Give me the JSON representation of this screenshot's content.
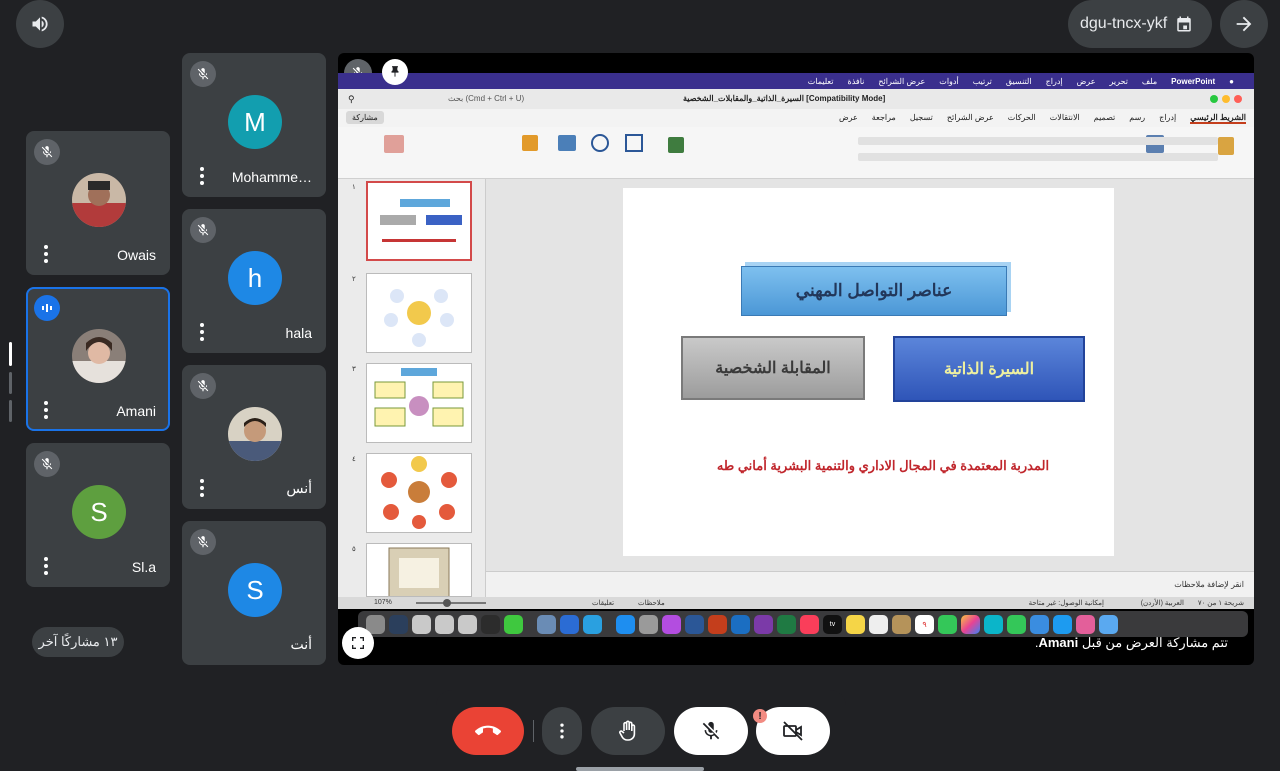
{
  "meeting": {
    "code": "dgu-tncx-ykf",
    "others_label": "١٣ مشاركًا آخر",
    "share_caption_prefix": "تتم مشاركة العرض من قبل",
    "share_caption_name": "Amani",
    "share_caption_suffix": "."
  },
  "participants": [
    {
      "name": "Owais",
      "muted": true
    },
    {
      "name": "Amani",
      "muted": false,
      "speaking": true
    },
    {
      "name": "Sl.a",
      "initial": "S",
      "color": "#5e9f3f",
      "muted": true
    },
    {
      "name": "Mohamme…",
      "initial": "M",
      "color": "#129eaf",
      "muted": true
    },
    {
      "name": "hala",
      "initial": "h",
      "color": "#1e88e5",
      "muted": true
    },
    {
      "name": "أنس",
      "muted": true
    },
    {
      "name": "أنت",
      "initial": "S",
      "color": "#1e88e5",
      "muted": true
    }
  ],
  "presentation": {
    "app_name": "PowerPoint",
    "menu": [
      "ملف",
      "تحرير",
      "عرض",
      "إدراج",
      "التنسيق",
      "ترتيب",
      "أدوات",
      "عرض الشرائح",
      "نافذة",
      "تعليمات"
    ],
    "doc_title": "السيرة_الذاتية_والمقابلات_الشخصية [Compatibility Mode]",
    "search_placeholder": "بحث (Cmd + Ctrl + U)",
    "share_btn": "مشاركة",
    "ribbon_tabs": [
      "الشريط الرئيسي",
      "إدراج",
      "رسم",
      "تصميم",
      "الانتقالات",
      "الحركات",
      "عرض الشرائح",
      "تسجيل",
      "مراجعة",
      "عرض"
    ],
    "slide_numbers": [
      "١",
      "٢",
      "٣",
      "٤",
      "٥"
    ],
    "slide": {
      "title": "عناصر التواصل المهني",
      "box_left": "المقابلة الشخصية",
      "box_right": "السيرة الذاتية",
      "footer": "المدربة المعتمدة في المجال الاداري والتنمية البشرية أماني طه"
    },
    "notes_placeholder": "انقر لإضافة ملاحظات",
    "status": {
      "slide_of": "شريحة ١ من ٧٠",
      "language": "العربية (الأردن)",
      "accessibility": "إمكانية الوصول: غير متاحة",
      "notes": "ملاحظات",
      "comments": "تعليقات",
      "zoom": "107%"
    },
    "dock_date": "٩"
  },
  "colors": {
    "background": "#202124",
    "tile": "#3c4043",
    "end_call": "#ea4335",
    "speaking_ring": "#1a73e8",
    "mac_menu": "#3a2f8d"
  }
}
